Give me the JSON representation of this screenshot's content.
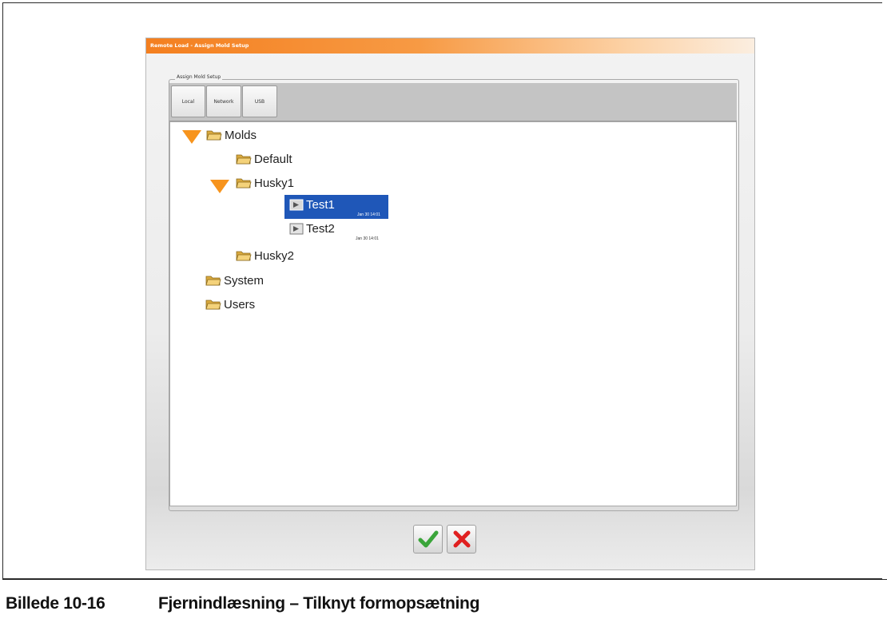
{
  "window": {
    "title": "Remote Load - Assign Mold Setup",
    "group_label": "Assign Mold Setup"
  },
  "tabs": [
    {
      "label": "Local"
    },
    {
      "label": "Network"
    },
    {
      "label": "USB"
    }
  ],
  "tree": {
    "molds": "Molds",
    "default": "Default",
    "husky1": "Husky1",
    "test1": {
      "label": "Test1",
      "date": "Jan 30 14:01"
    },
    "test2": {
      "label": "Test2",
      "date": "Jan 30 14:01"
    },
    "husky2": "Husky2",
    "system": "System",
    "users": "Users",
    "selected": "Test1"
  },
  "buttons": {
    "ok_icon": "checkmark-icon",
    "cancel_icon": "x-icon",
    "ok_color": "#3aa53a",
    "cancel_color": "#e02020"
  },
  "colors": {
    "titlebar_accent": "#f47f1f",
    "expander": "#f7941d",
    "selection": "#1f57b8"
  },
  "caption": {
    "number": "Billede 10-16",
    "title": "Fjernindlæsning – Tilknyt formopsætning"
  }
}
